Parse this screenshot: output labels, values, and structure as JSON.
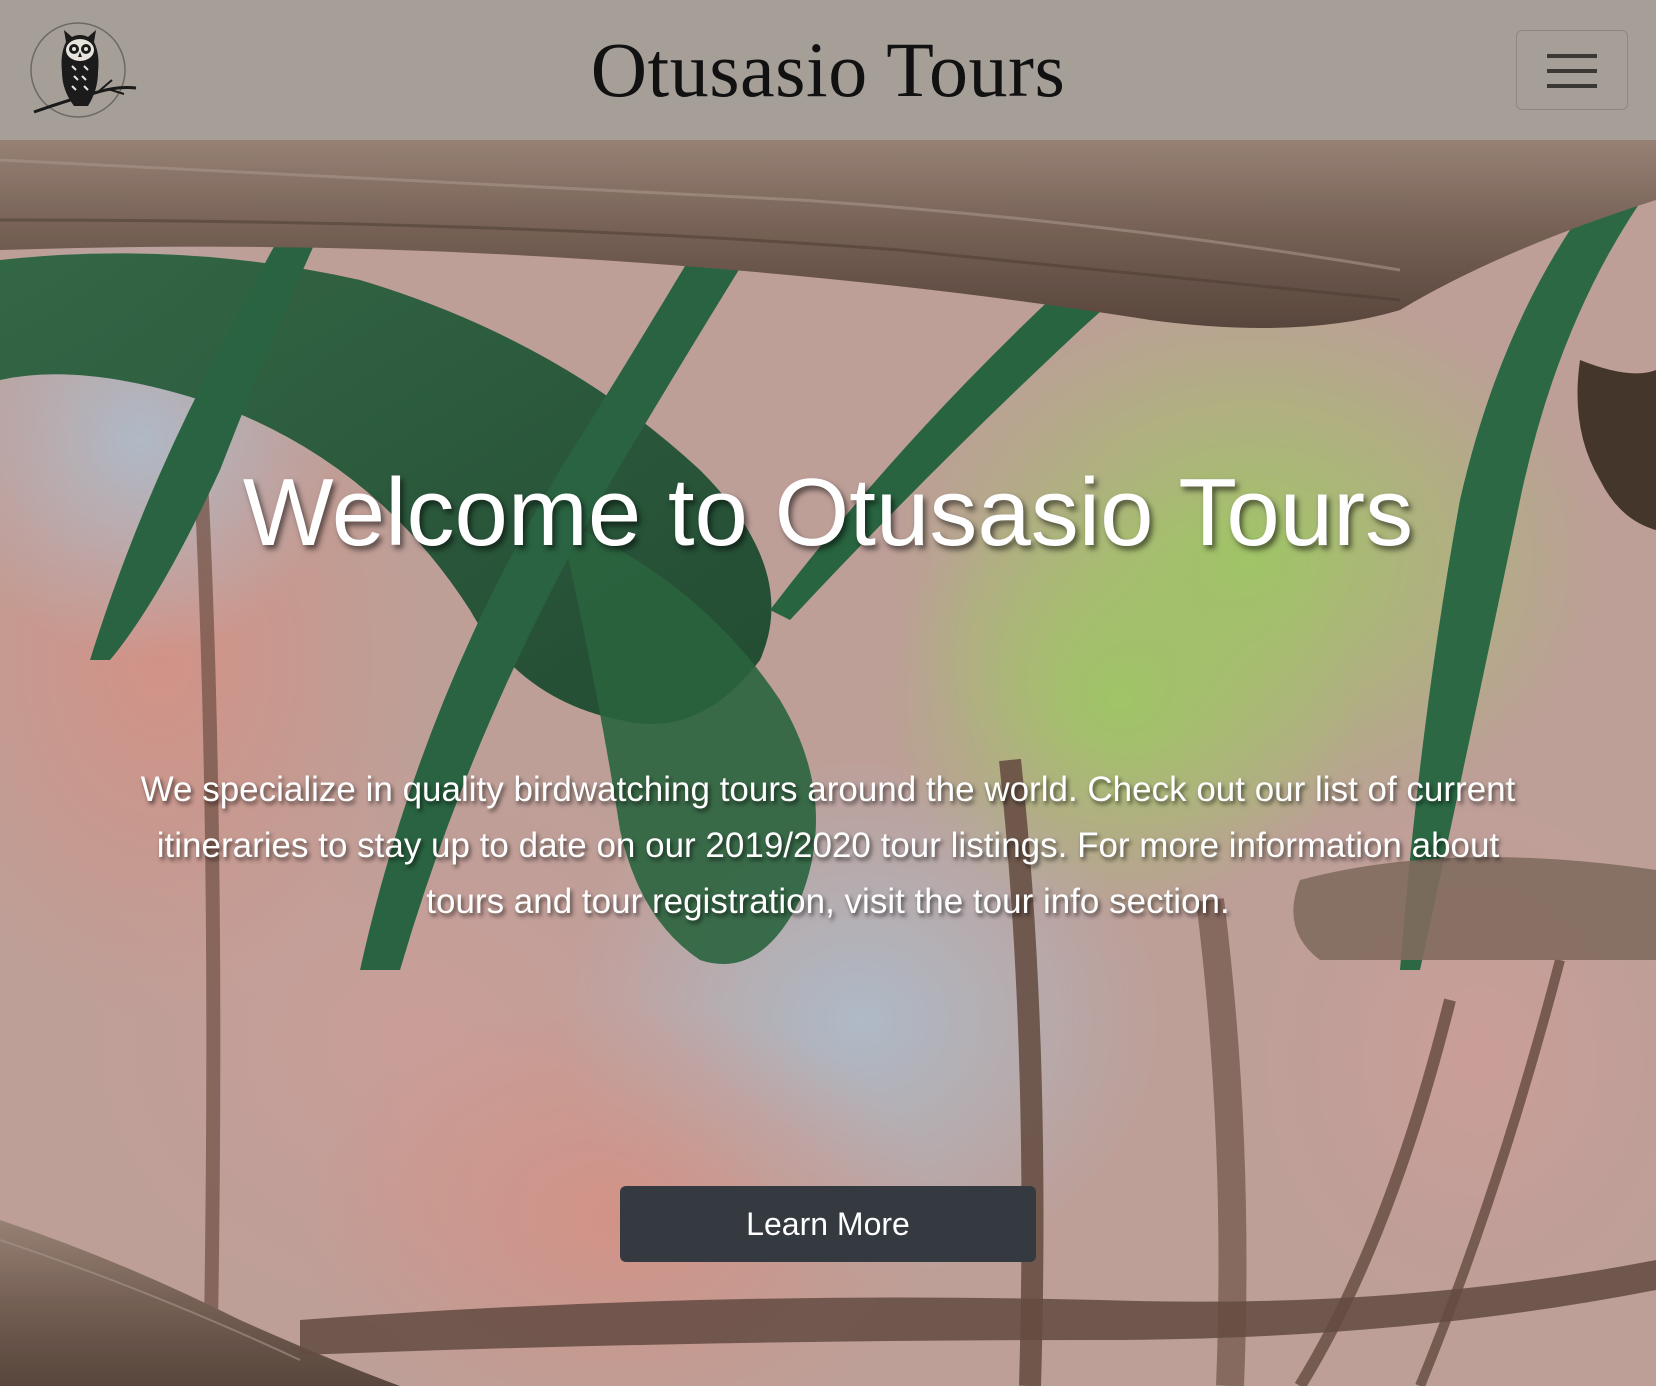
{
  "navbar": {
    "brand_title": "Otusasio Tours",
    "logo_icon": "owl-logo-icon",
    "toggler_icon": "hamburger-menu-icon"
  },
  "hero": {
    "title": "Welcome to Otusasio Tours",
    "text": "We specialize in quality birdwatching tours around the world. Check out our list of current itineraries to stay up to date on our 2019/2020 tour listings. For more information about tours and tour registration, visit the tour info section.",
    "button_label": "Learn More"
  },
  "colors": {
    "navbar_bg": "#a59f98",
    "button_bg": "#343a40",
    "hero_text": "#ffffff"
  }
}
